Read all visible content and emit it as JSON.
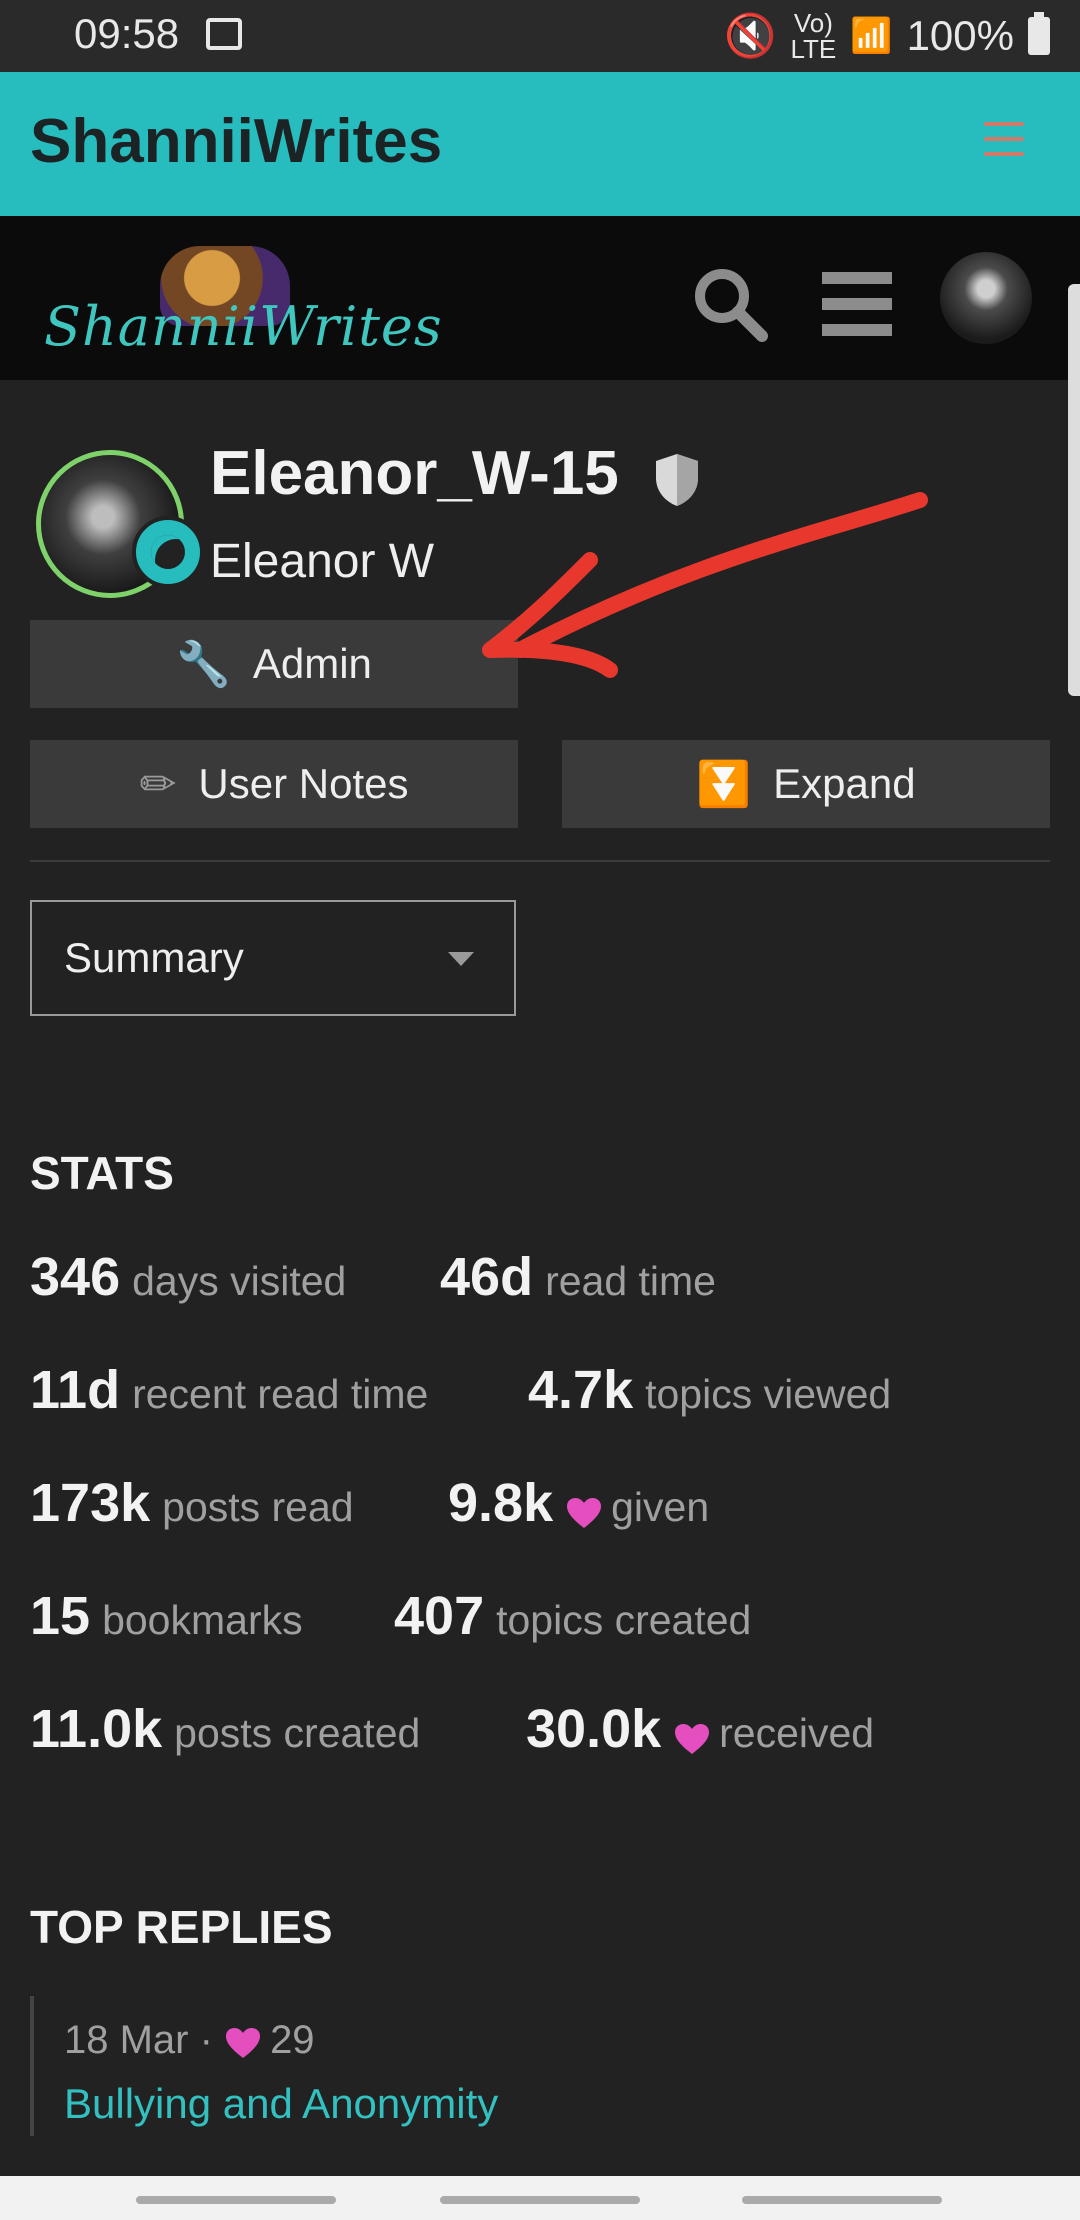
{
  "status_bar": {
    "time": "09:58",
    "volte_top": "Vo)",
    "volte_bottom": "LTE",
    "battery": "100%"
  },
  "site": {
    "title": "ShanniiWrites",
    "logo_text": "ShanniiWrites"
  },
  "profile": {
    "username": "Eleanor_W-15",
    "full_name": "Eleanor W",
    "admin_label": "Admin",
    "user_notes_label": "User Notes",
    "expand_label": "Expand"
  },
  "dropdown": {
    "selected": "Summary"
  },
  "stats": {
    "heading": "STATS",
    "items": [
      {
        "value": "346",
        "label": "days visited"
      },
      {
        "value": "46d",
        "label": "read time"
      },
      {
        "value": "11d",
        "label": "recent read time"
      },
      {
        "value": "4.7k",
        "label": "topics viewed"
      },
      {
        "value": "173k",
        "label": "posts read"
      },
      {
        "value": "9.8k",
        "label": "given"
      },
      {
        "value": "15",
        "label": "bookmarks"
      },
      {
        "value": "407",
        "label": "topics created"
      },
      {
        "value": "11.0k",
        "label": "posts created"
      },
      {
        "value": "30.0k",
        "label": "received"
      }
    ]
  },
  "top_replies": {
    "heading": "TOP REPLIES",
    "items": [
      {
        "date": "18 Mar ·",
        "likes": "29",
        "title": "Bullying and Anonymity"
      }
    ]
  },
  "colors": {
    "accent": "#27bcbd",
    "heart": "#e44ebf",
    "annotation_arrow": "#e8382e"
  }
}
